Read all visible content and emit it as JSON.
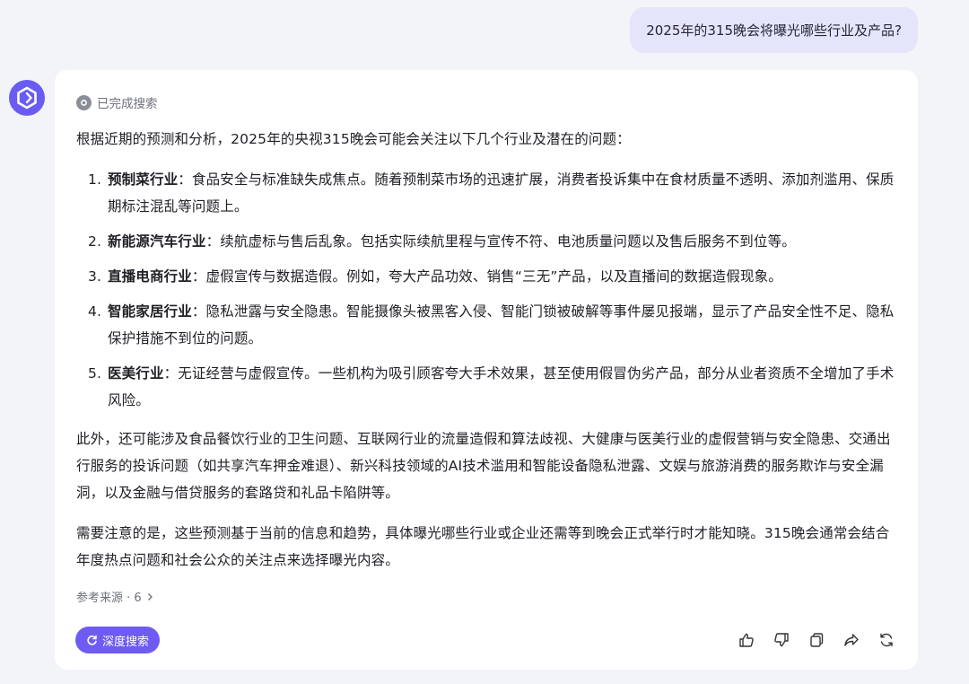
{
  "user_message": "2025年的315晚会将曝光哪些行业及产品?",
  "answer": {
    "search_status": "已完成搜索",
    "intro": "根据近期的预测和分析，2025年的央视315晚会可能会关注以下几个行业及潜在的问题：",
    "items": [
      {
        "num": "1.",
        "title": "预制菜行业",
        "body": "：食品安全与标准缺失成焦点。随着预制菜市场的迅速扩展，消费者投诉集中在食材质量不透明、添加剂滥用、保质期标注混乱等问题上。"
      },
      {
        "num": "2.",
        "title": "新能源汽车行业",
        "body": "：续航虚标与售后乱象。包括实际续航里程与宣传不符、电池质量问题以及售后服务不到位等。"
      },
      {
        "num": "3.",
        "title": "直播电商行业",
        "body": "：虚假宣传与数据造假。例如，夸大产品功效、销售“三无”产品，以及直播间的数据造假现象。"
      },
      {
        "num": "4.",
        "title": "智能家居行业",
        "body": "：隐私泄露与安全隐患。智能摄像头被黑客入侵、智能门锁被破解等事件屡见报端，显示了产品安全性不足、隐私保护措施不到位的问题。"
      },
      {
        "num": "5.",
        "title": "医美行业",
        "body": "：无证经营与虚假宣传。一些机构为吸引顾客夸大手术效果，甚至使用假冒伪劣产品，部分从业者资质不全增加了手术风险。"
      }
    ],
    "paragraph2": "此外，还可能涉及食品餐饮行业的卫生问题、互联网行业的流量造假和算法歧视、大健康与医美行业的虚假营销与安全隐患、交通出行服务的投诉问题（如共享汽车押金难退）、新兴科技领域的AI技术滥用和智能设备隐私泄露、文娱与旅游消费的服务欺诈与安全漏洞，以及金融与借贷服务的套路贷和礼品卡陷阱等。",
    "paragraph3": "需要注意的是，这些预测基于当前的信息和趋势，具体曝光哪些行业或企业还需等到晚会正式举行时才能知晓。315晚会通常会结合年度热点问题和社会公众的关注点来选择曝光内容。",
    "references": "参考来源 · 6",
    "deep_search_label": "深度搜索"
  },
  "colors": {
    "accent": "#6e5cf2",
    "user_bubble": "#e4e4fb",
    "background": "#f3f4f8"
  }
}
